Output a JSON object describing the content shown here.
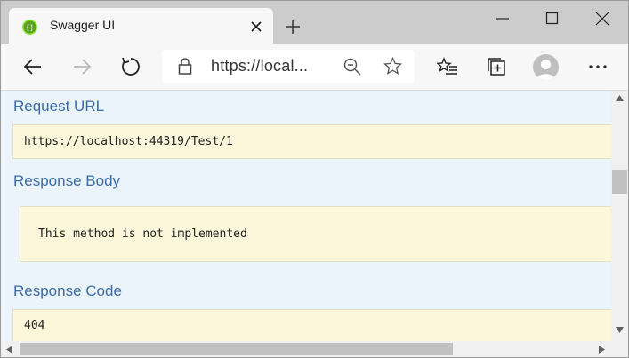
{
  "browser": {
    "tab_title": "Swagger UI",
    "address": "https://local...",
    "accent": "#85ea2d"
  },
  "icons": {
    "favicon": "swagger-favicon-icon",
    "tab_close": "close-icon",
    "new_tab": "plus-icon",
    "minimize": "minimize-icon",
    "maximize": "maximize-icon",
    "close_window": "close-icon",
    "back": "arrow-left-icon",
    "forward": "arrow-right-icon",
    "refresh": "refresh-icon",
    "lock": "lock-icon",
    "zoom": "zoom-out-icon",
    "favorite": "star-icon",
    "favorites": "favorites-list-icon",
    "collections": "collections-icon",
    "profile": "avatar",
    "menu": "more-icon"
  },
  "response": {
    "request_url_label": "Request URL",
    "request_url": "https://localhost:44319/Test/1",
    "body_label": "Response Body",
    "body": "This method is not implemented",
    "code_label": "Response Code",
    "code": "404"
  }
}
